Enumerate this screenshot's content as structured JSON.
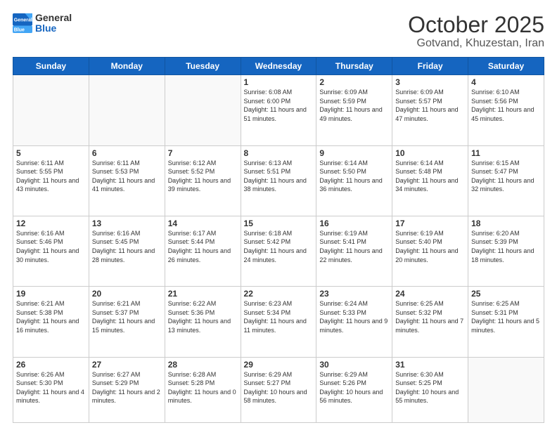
{
  "header": {
    "logo_general": "General",
    "logo_blue": "Blue",
    "month": "October 2025",
    "location": "Gotvand, Khuzestan, Iran"
  },
  "weekdays": [
    "Sunday",
    "Monday",
    "Tuesday",
    "Wednesday",
    "Thursday",
    "Friday",
    "Saturday"
  ],
  "weeks": [
    [
      {
        "day": "",
        "empty": true
      },
      {
        "day": "",
        "empty": true
      },
      {
        "day": "",
        "empty": true
      },
      {
        "day": "1",
        "sunrise": "6:08 AM",
        "sunset": "6:00 PM",
        "daylight": "11 hours and 51 minutes."
      },
      {
        "day": "2",
        "sunrise": "6:09 AM",
        "sunset": "5:59 PM",
        "daylight": "11 hours and 49 minutes."
      },
      {
        "day": "3",
        "sunrise": "6:09 AM",
        "sunset": "5:57 PM",
        "daylight": "11 hours and 47 minutes."
      },
      {
        "day": "4",
        "sunrise": "6:10 AM",
        "sunset": "5:56 PM",
        "daylight": "11 hours and 45 minutes."
      }
    ],
    [
      {
        "day": "5",
        "sunrise": "6:11 AM",
        "sunset": "5:55 PM",
        "daylight": "11 hours and 43 minutes."
      },
      {
        "day": "6",
        "sunrise": "6:11 AM",
        "sunset": "5:53 PM",
        "daylight": "11 hours and 41 minutes."
      },
      {
        "day": "7",
        "sunrise": "6:12 AM",
        "sunset": "5:52 PM",
        "daylight": "11 hours and 39 minutes."
      },
      {
        "day": "8",
        "sunrise": "6:13 AM",
        "sunset": "5:51 PM",
        "daylight": "11 hours and 38 minutes."
      },
      {
        "day": "9",
        "sunrise": "6:14 AM",
        "sunset": "5:50 PM",
        "daylight": "11 hours and 36 minutes."
      },
      {
        "day": "10",
        "sunrise": "6:14 AM",
        "sunset": "5:48 PM",
        "daylight": "11 hours and 34 minutes."
      },
      {
        "day": "11",
        "sunrise": "6:15 AM",
        "sunset": "5:47 PM",
        "daylight": "11 hours and 32 minutes."
      }
    ],
    [
      {
        "day": "12",
        "sunrise": "6:16 AM",
        "sunset": "5:46 PM",
        "daylight": "11 hours and 30 minutes."
      },
      {
        "day": "13",
        "sunrise": "6:16 AM",
        "sunset": "5:45 PM",
        "daylight": "11 hours and 28 minutes."
      },
      {
        "day": "14",
        "sunrise": "6:17 AM",
        "sunset": "5:44 PM",
        "daylight": "11 hours and 26 minutes."
      },
      {
        "day": "15",
        "sunrise": "6:18 AM",
        "sunset": "5:42 PM",
        "daylight": "11 hours and 24 minutes."
      },
      {
        "day": "16",
        "sunrise": "6:19 AM",
        "sunset": "5:41 PM",
        "daylight": "11 hours and 22 minutes."
      },
      {
        "day": "17",
        "sunrise": "6:19 AM",
        "sunset": "5:40 PM",
        "daylight": "11 hours and 20 minutes."
      },
      {
        "day": "18",
        "sunrise": "6:20 AM",
        "sunset": "5:39 PM",
        "daylight": "11 hours and 18 minutes."
      }
    ],
    [
      {
        "day": "19",
        "sunrise": "6:21 AM",
        "sunset": "5:38 PM",
        "daylight": "11 hours and 16 minutes."
      },
      {
        "day": "20",
        "sunrise": "6:21 AM",
        "sunset": "5:37 PM",
        "daylight": "11 hours and 15 minutes."
      },
      {
        "day": "21",
        "sunrise": "6:22 AM",
        "sunset": "5:36 PM",
        "daylight": "11 hours and 13 minutes."
      },
      {
        "day": "22",
        "sunrise": "6:23 AM",
        "sunset": "5:34 PM",
        "daylight": "11 hours and 11 minutes."
      },
      {
        "day": "23",
        "sunrise": "6:24 AM",
        "sunset": "5:33 PM",
        "daylight": "11 hours and 9 minutes."
      },
      {
        "day": "24",
        "sunrise": "6:25 AM",
        "sunset": "5:32 PM",
        "daylight": "11 hours and 7 minutes."
      },
      {
        "day": "25",
        "sunrise": "6:25 AM",
        "sunset": "5:31 PM",
        "daylight": "11 hours and 5 minutes."
      }
    ],
    [
      {
        "day": "26",
        "sunrise": "6:26 AM",
        "sunset": "5:30 PM",
        "daylight": "11 hours and 4 minutes."
      },
      {
        "day": "27",
        "sunrise": "6:27 AM",
        "sunset": "5:29 PM",
        "daylight": "11 hours and 2 minutes."
      },
      {
        "day": "28",
        "sunrise": "6:28 AM",
        "sunset": "5:28 PM",
        "daylight": "11 hours and 0 minutes."
      },
      {
        "day": "29",
        "sunrise": "6:29 AM",
        "sunset": "5:27 PM",
        "daylight": "10 hours and 58 minutes."
      },
      {
        "day": "30",
        "sunrise": "6:29 AM",
        "sunset": "5:26 PM",
        "daylight": "10 hours and 56 minutes."
      },
      {
        "day": "31",
        "sunrise": "6:30 AM",
        "sunset": "5:25 PM",
        "daylight": "10 hours and 55 minutes."
      },
      {
        "day": "",
        "empty": true
      }
    ]
  ]
}
